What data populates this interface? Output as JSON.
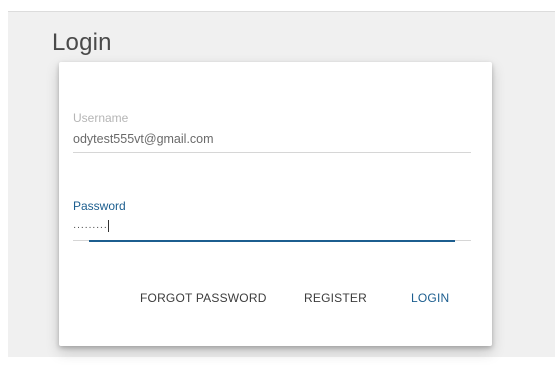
{
  "page": {
    "title": "Login"
  },
  "form": {
    "username": {
      "label": "Username",
      "value": "odytest555vt@gmail.com"
    },
    "password": {
      "label": "Password",
      "masked_value": "·········"
    }
  },
  "actions": {
    "forgot_password": "FORGOT PASSWORD",
    "register": "REGISTER",
    "login": "LOGIN"
  },
  "colors": {
    "accent": "#1c5e8f",
    "background": "#f0f0f0",
    "card": "#ffffff"
  }
}
